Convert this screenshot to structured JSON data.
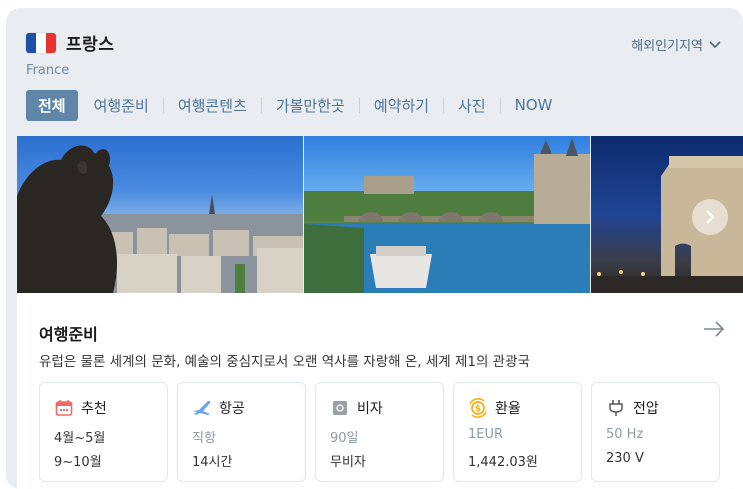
{
  "header": {
    "country": "프랑스",
    "country_en": "France",
    "flag_colors": [
      "#1f4fa8",
      "#ffffff",
      "#e8322f"
    ],
    "popular_label": "해외인기지역"
  },
  "tabs": [
    {
      "label": "전체",
      "active": true
    },
    {
      "label": "여행준비"
    },
    {
      "label": "여행콘텐츠"
    },
    {
      "label": "가볼만한곳"
    },
    {
      "label": "예약하기"
    },
    {
      "label": "사진"
    },
    {
      "label": "NOW"
    }
  ],
  "gallery": {
    "photos": [
      "paris-gargoyle-skyline-photo",
      "seine-river-boat-photo",
      "arc-de-triomphe-night-photo"
    ],
    "next_icon": "chevron-right-icon"
  },
  "info": {
    "title": "여행준비",
    "description": "유럽은 물론 세계의 문화, 예술의 중심지로서 오랜 역사를 자랑해 온, 세계 제1의 관광국",
    "stats": [
      {
        "icon": "calendar-icon",
        "name": "추천",
        "line1": "4월~5월",
        "line2": "9~10월",
        "line1_muted": false
      },
      {
        "icon": "airplane-icon",
        "name": "항공",
        "line1": "직항",
        "line2": "14시간",
        "line1_muted": true
      },
      {
        "icon": "passport-icon",
        "name": "비자",
        "line1": "90일",
        "line2": "무비자",
        "line1_muted": true
      },
      {
        "icon": "exchange-icon",
        "name": "환율",
        "line1": "1EUR",
        "line2": "1,442.03원",
        "line1_muted": true
      },
      {
        "icon": "plug-icon",
        "name": "전압",
        "line1": "50 Hz",
        "line2": "230 V",
        "line1_muted": true
      }
    ]
  },
  "colors": {
    "accent": "#5f86a8",
    "tab_text": "#4f7596",
    "card_bg": "#e9edf2"
  }
}
